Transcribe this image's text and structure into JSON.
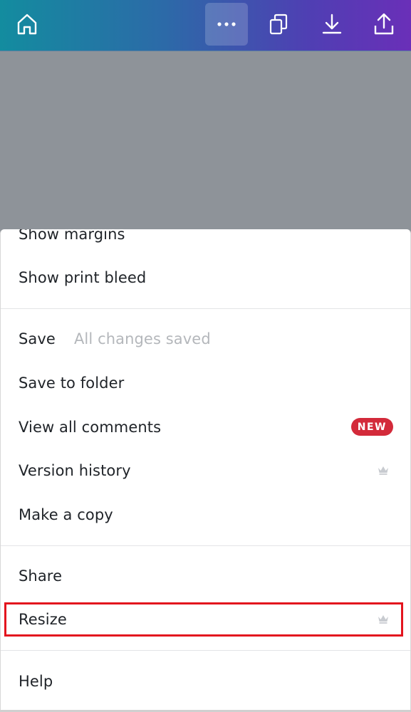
{
  "toolbar": {
    "home": "home-icon",
    "more": "more-horizontal-icon",
    "pages": "pages-copy-icon",
    "download": "download-icon",
    "share": "upload-share-icon"
  },
  "menu": {
    "show_margins": "Show margins",
    "show_print_bleed": "Show print bleed",
    "save": "Save",
    "save_status": "All changes saved",
    "save_to_folder": "Save to folder",
    "view_all_comments": "View all comments",
    "new_badge": "NEW",
    "version_history": "Version history",
    "make_a_copy": "Make a copy",
    "share": "Share",
    "resize": "Resize",
    "help": "Help"
  },
  "colors": {
    "new_badge": "#d32a3a",
    "highlight": "#e3141e",
    "crown": "#c8cbd0"
  }
}
